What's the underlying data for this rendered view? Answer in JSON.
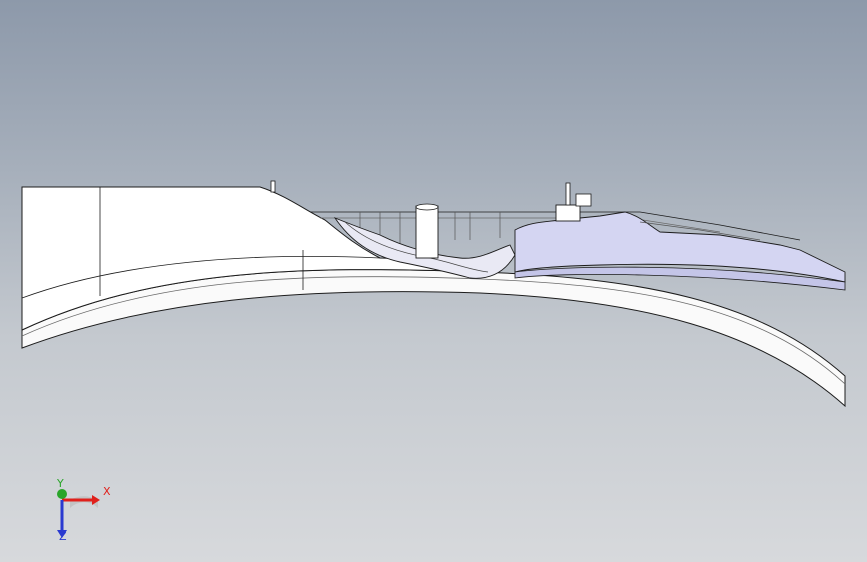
{
  "viewport": {
    "background_top": "#8d99aa",
    "background_bottom": "#d7d9dc"
  },
  "model": {
    "body_color": "#ffffff",
    "edge_color": "#1c1c1c",
    "highlight_color": "#cfd0ee"
  },
  "triad": {
    "x_label": "X",
    "y_label": "Y",
    "z_label": "Z",
    "x_color": "#e0201c",
    "y_color": "#2aa52a",
    "z_color": "#2a3ad0"
  }
}
